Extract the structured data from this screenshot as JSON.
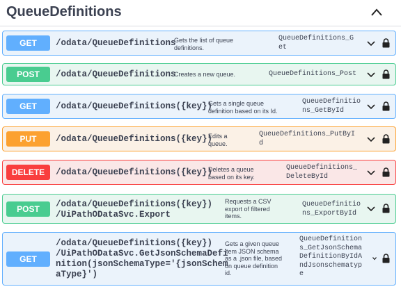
{
  "section": {
    "title": "QueueDefinitions"
  },
  "operations": [
    {
      "method": "GET",
      "path": "/odata/QueueDefinitions",
      "description": "Gets the list of queue\ndefinitions.",
      "operation_id": "QueueDefinitions_G\net"
    },
    {
      "method": "POST",
      "path": "/odata/QueueDefinitions",
      "description": "Creates a new queue.",
      "operation_id": "QueueDefinitions_Post"
    },
    {
      "method": "GET",
      "path": "/odata/QueueDefinitions({key})",
      "description": "Gets a single queue\ndefinition based on its Id.",
      "operation_id": "QueueDefinitio\nns_GetById"
    },
    {
      "method": "PUT",
      "path": "/odata/QueueDefinitions({key})",
      "description": "Edits a\nqueue.",
      "operation_id": "QueueDefinitions_PutByI\nd"
    },
    {
      "method": "DELETE",
      "path": "/odata/QueueDefinitions({key})",
      "description": "Deletes a queue\nbased on its key.",
      "operation_id": "QueueDefinitions_\nDeleteById"
    },
    {
      "method": "POST",
      "path": "/odata/QueueDefinitions({key})\n/UiPathODataSvc.Export",
      "description": "Requests a CSV\nexport of filtered\nitems.",
      "operation_id": "QueueDefinitio\nns_ExportById"
    },
    {
      "method": "GET",
      "path": "/odata/QueueDefinitions({key})\n/UiPathODataSvc.GetJsonSchemaDefi\nnition(jsonSchemaType='{jsonSchem\naType}')",
      "description": "Gets a given queue\nitem JSON schema\nas a .json file, based\non queue definition\nid.",
      "operation_id": "QueueDefinition\ns_GetJsonSchema\nDefinitionByIdA\nndJsonschematyp\ne"
    }
  ]
}
